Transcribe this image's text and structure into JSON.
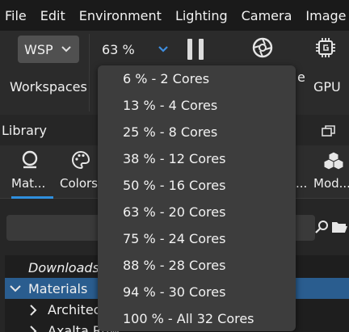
{
  "menubar": [
    "File",
    "Edit",
    "Environment",
    "Lighting",
    "Camera",
    "Image"
  ],
  "toolbar": {
    "workspace_value": "WSP",
    "workspaces_label": "Workspaces",
    "performance_value": "63 %",
    "render_label_fragment": "e",
    "gpu_label": "GPU",
    "icons": {
      "pause": "pause-icon",
      "render": "render-mode-icon",
      "gpu": "gpu-chip-icon"
    }
  },
  "library": {
    "title": "Library",
    "tabs": [
      {
        "label": "Mat...",
        "icon": "material-sphere-icon",
        "active": true
      },
      {
        "label": "Colors",
        "icon": "palette-icon",
        "active": false
      },
      {
        "label": "...",
        "icon": "",
        "active": false
      },
      {
        "label": "Mod...",
        "icon": "models-cubes-icon",
        "active": false
      }
    ],
    "search_placeholder": "",
    "tree": [
      {
        "label": "Downloads",
        "italic": true,
        "selected": false,
        "expanded": null
      },
      {
        "label": "Materials",
        "italic": false,
        "selected": true,
        "expanded": true
      },
      {
        "label": "Architect",
        "italic": false,
        "selected": false,
        "expanded": false
      },
      {
        "label": "Axalta Ruw",
        "italic": false,
        "selected": false,
        "expanded": false
      }
    ]
  },
  "dropdown": {
    "options": [
      "6 % - 2 Cores",
      "13 % - 4 Cores",
      "25 % - 8 Cores",
      "38 % - 12 Cores",
      "50 % - 16 Cores",
      "63 % - 20 Cores",
      "75 % - 24 Cores",
      "88 % - 28 Cores",
      "94 % - 30 Cores",
      "100 % - All 32 Cores"
    ]
  },
  "colors": {
    "accent": "#2f8fde",
    "selection": "#2a5d8f",
    "dropdown_bg": "#3d3d3d",
    "chevron": "#3e8ee0"
  }
}
